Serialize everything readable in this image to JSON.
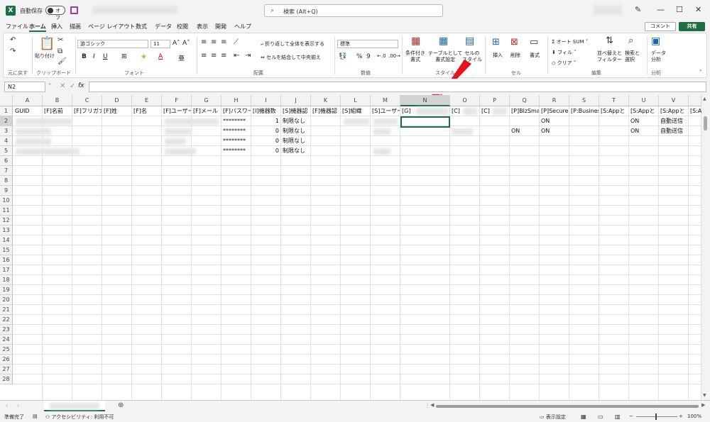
{
  "titlebar": {
    "autosave_label": "自動保存",
    "toggle_label": "オフ",
    "search_placeholder": "検索 (Alt+Q)"
  },
  "menu": [
    "ファイル",
    "ホーム",
    "挿入",
    "描画",
    "ページ レイアウト",
    "数式",
    "データ",
    "校閲",
    "表示",
    "開発",
    "ヘルプ"
  ],
  "menu_active": "ホーム",
  "actions": {
    "comment": "コメント",
    "share": "共有"
  },
  "ribbon": {
    "groups": [
      "元に戻す",
      "クリップボード",
      "フォント",
      "配置",
      "数値",
      "スタイル",
      "セル",
      "編集",
      "分析"
    ],
    "paste": "貼り付け",
    "font_name": "游ゴシック",
    "font_size": "11",
    "wrap_text": "折り返して全体を表示する",
    "merge_center": "セルを結合して中央揃え",
    "number_format": "標準",
    "cond_format": "条件付き\n書式",
    "table_format": "テーブルとして\n書式設定",
    "cell_style": "セルの\nスタイル",
    "insert": "挿入",
    "delete": "削除",
    "format": "書式",
    "autosum": "オート SUM",
    "fill": "フィル",
    "clear": "クリア",
    "sort_filter": "並べ替えと\nフィルター",
    "find_select": "検索と\n選択",
    "data_analysis": "データ\n分析"
  },
  "formula_bar": {
    "name_box": "N2",
    "fx": "fx",
    "content": ""
  },
  "columns": [
    "A",
    "B",
    "C",
    "D",
    "E",
    "F",
    "G",
    "H",
    "I",
    "J",
    "K",
    "L",
    "M",
    "N",
    "O",
    "P",
    "Q",
    "R",
    "S",
    "T",
    "U",
    "V",
    ""
  ],
  "selected_column": "N",
  "rows": [
    "1",
    "2",
    "3",
    "4",
    "5",
    "6",
    "7",
    "8",
    "9",
    "10",
    "11",
    "12",
    "13",
    "14",
    "15",
    "16",
    "17",
    "18",
    "19",
    "20",
    "21",
    "22",
    "23",
    "24",
    "25",
    "26",
    "27",
    "28"
  ],
  "selected_row": "2",
  "headers": [
    "GUID",
    "[F]名前",
    "[F]フリガナ",
    "[F]姓",
    "[F]名",
    "[F]ユーザー",
    "[F]メール",
    "[F]パスワード",
    "[I]機器数",
    "[S]機器認",
    "[F]機器認",
    "[S]組織",
    "[S]ユーザー",
    "[G]",
    "[C]",
    "[C]",
    "[P]BizSmart",
    "[P]Secure",
    "[P:Business",
    "[S:Appと",
    "[S:Appと",
    "[S:Appと",
    "[S:A"
  ],
  "data_rows": [
    {
      "password": "********",
      "count": "1",
      "limit": "制限なし",
      "q": "",
      "r": "ON",
      "u": "ON",
      "v": "自動送信"
    },
    {
      "password": "********",
      "count": "0",
      "limit": "制限なし",
      "q": "ON",
      "r": "ON",
      "u": "ON",
      "v": "自動送信"
    },
    {
      "password": "********",
      "count": "0",
      "limit": "制限なし",
      "q": "",
      "r": "",
      "u": "",
      "v": ""
    },
    {
      "password": "********",
      "count": "0",
      "limit": "制限なし",
      "q": "",
      "r": "",
      "u": "",
      "v": ""
    }
  ],
  "status": {
    "ready": "準備完了",
    "accessibility": "アクセシビリティ: 利用不可",
    "display_settings": "表示設定",
    "zoom": "100%"
  },
  "colors": {
    "accent": "#1d6f42",
    "arrow": "#e8131a"
  }
}
